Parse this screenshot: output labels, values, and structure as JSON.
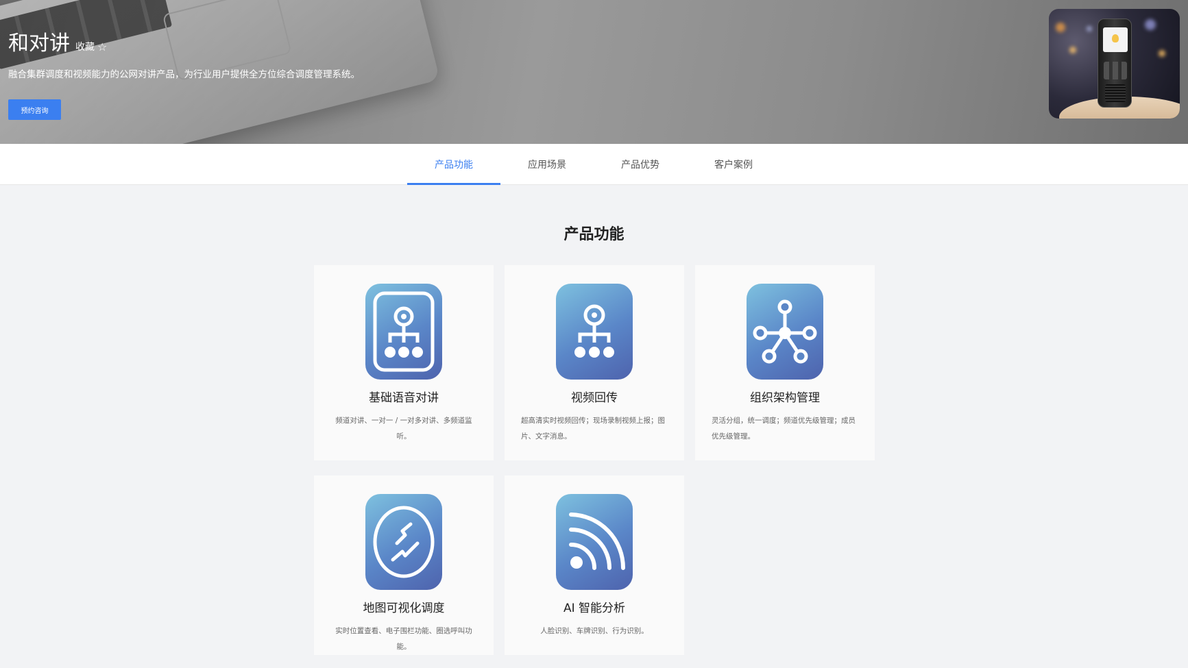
{
  "hero": {
    "title": "和对讲",
    "favorite_label": "收藏",
    "favorite_icon": "star-outline-icon",
    "description": "融合集群调度和视频能力的公网对讲产品，为行业用户提供全方位综合调度管理系统。",
    "consult_button": "预约咨询",
    "colors": {
      "button": "#3b7ff0"
    }
  },
  "tabs": [
    {
      "label": "产品功能",
      "active": true
    },
    {
      "label": "应用场景",
      "active": false
    },
    {
      "label": "产品优势",
      "active": false
    },
    {
      "label": "客户案例",
      "active": false
    }
  ],
  "section": {
    "title": "产品功能",
    "cards": [
      {
        "title": "基础语音对讲",
        "desc": "频道对讲、一对一 / 一对多对讲、多频道监听。",
        "icon": "org-chart-framed-icon"
      },
      {
        "title": "视频回传",
        "desc": "超高清实时视频回传；现场录制视频上报；图片、文字消息。",
        "icon": "org-chart-icon"
      },
      {
        "title": "组织架构管理",
        "desc": "灵活分组，统一调度；频道优先级管理；成员优先级管理。",
        "icon": "network-hub-icon"
      },
      {
        "title": "地图可视化调度",
        "desc": "实时位置查看、电子围栏功能、圈选呼叫功能。",
        "icon": "map-route-icon"
      },
      {
        "title": "AI 智能分析",
        "desc": "人脸识别、车牌识别、行为识别。",
        "icon": "signal-waves-icon"
      }
    ]
  },
  "accent_color": "#3b7ff0"
}
